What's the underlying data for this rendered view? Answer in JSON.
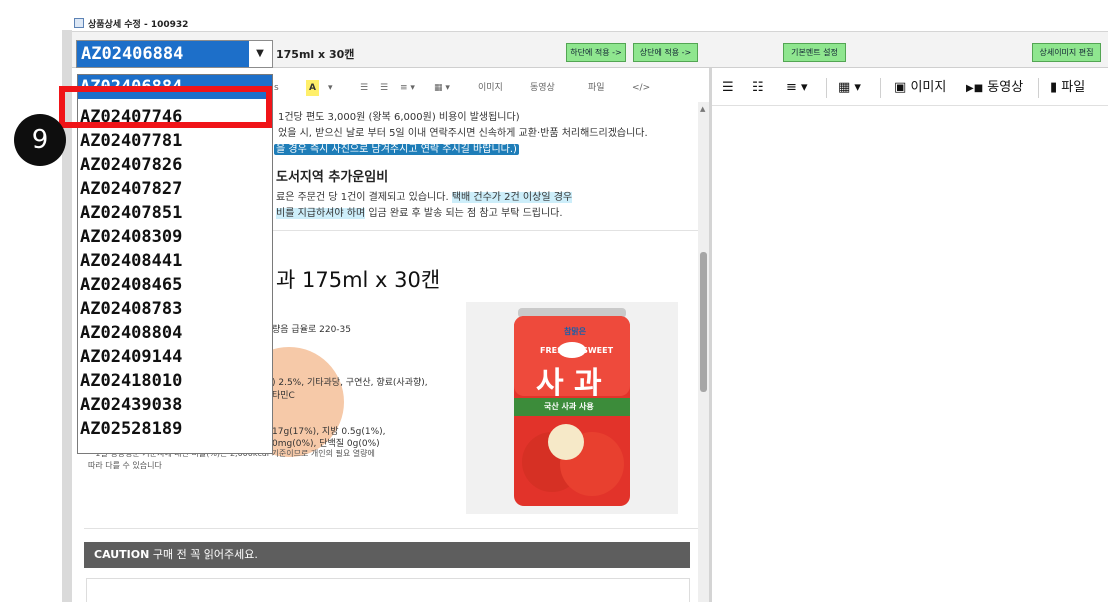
{
  "window": {
    "title": "상품상세 수정 - 100932"
  },
  "toolbar": {
    "selected_code": "AZ02406884",
    "product_name": "175ml x 30캔",
    "apply_bottom_label": "하단에 적용 ->",
    "apply_top_label": "상단에 적용 ->",
    "basic_content_label": "기본멘트 설정",
    "detail_image_label": "상세이미지 편집"
  },
  "editor_toolbar": {
    "items": [
      "s",
      "A",
      "▾",
      "☰",
      "☰",
      "≡ ▾",
      "▦ ▾",
      "이미지",
      "동영상",
      "파일",
      "</>"
    ]
  },
  "right_toolbar": {
    "image_label": "이미지",
    "video_label": "동영상",
    "file_label": "파일"
  },
  "content": {
    "line1": "1건당 편도 3,000원 (왕복 6,000원) 비용이 발생됩니다)",
    "line2": "었을 시, 받으신 날로 부터 5일 이내 연락주시면 신속하게 교환·반품 처리해드리겠습니다.",
    "line3": "을 경우 즉시 사진으로 남겨주시고 연락 주시길 바랍니다.)",
    "heading": "도서지역 추가운임비",
    "line4_a": "료은 주문건 당 1건이 결제되고 있습니다. ",
    "line4_b": "택배 건수가 2건 이상일 경우",
    "line5_a": "비를 지급하셔야 하며",
    "line5_b": " 입금 완료 후 발송 되는 점 참고 부탁 드립니다.",
    "product_title": "과 175ml x 30캔",
    "spec1": "량음 급율로 220-35",
    "spec2": ") 2.5%, 기타과당, 구연산, 향료(사과향),",
    "spec3": "타민C",
    "spec4": "17g(17%), 지방 0.5g(1%),",
    "spec5": "0mg(0%), 단백질 0g(0%)",
    "spec6": "• 1일 영양성분 기준치에 대한 비율(%)은 2,000kcal 기준이므로 개인의 필요 열량에",
    "spec7": "따라 다를 수 있습니다",
    "can_brand": "참맑은",
    "can_tagline": "FRESH & SWEET",
    "can_name": "사 과",
    "can_sub": "국산 사과 사용",
    "caution_bold": "CAUTION",
    "caution_text": " 구매 전 꼭 읽어주세요."
  },
  "dropdown": {
    "items": [
      "AZ02406884",
      "AZ02407746",
      "AZ02407781",
      "AZ02407826",
      "AZ02407827",
      "AZ02407851",
      "AZ02408309",
      "AZ02408441",
      "AZ02408465",
      "AZ02408783",
      "AZ02408804",
      "AZ02409144",
      "AZ02418010",
      "AZ02439038",
      "AZ02528189"
    ]
  },
  "annotation": {
    "step_number": "9"
  },
  "colors": {
    "selection": "#1d6fc9",
    "highlight_red": "#f01418",
    "green_button": "#8fe68f"
  }
}
